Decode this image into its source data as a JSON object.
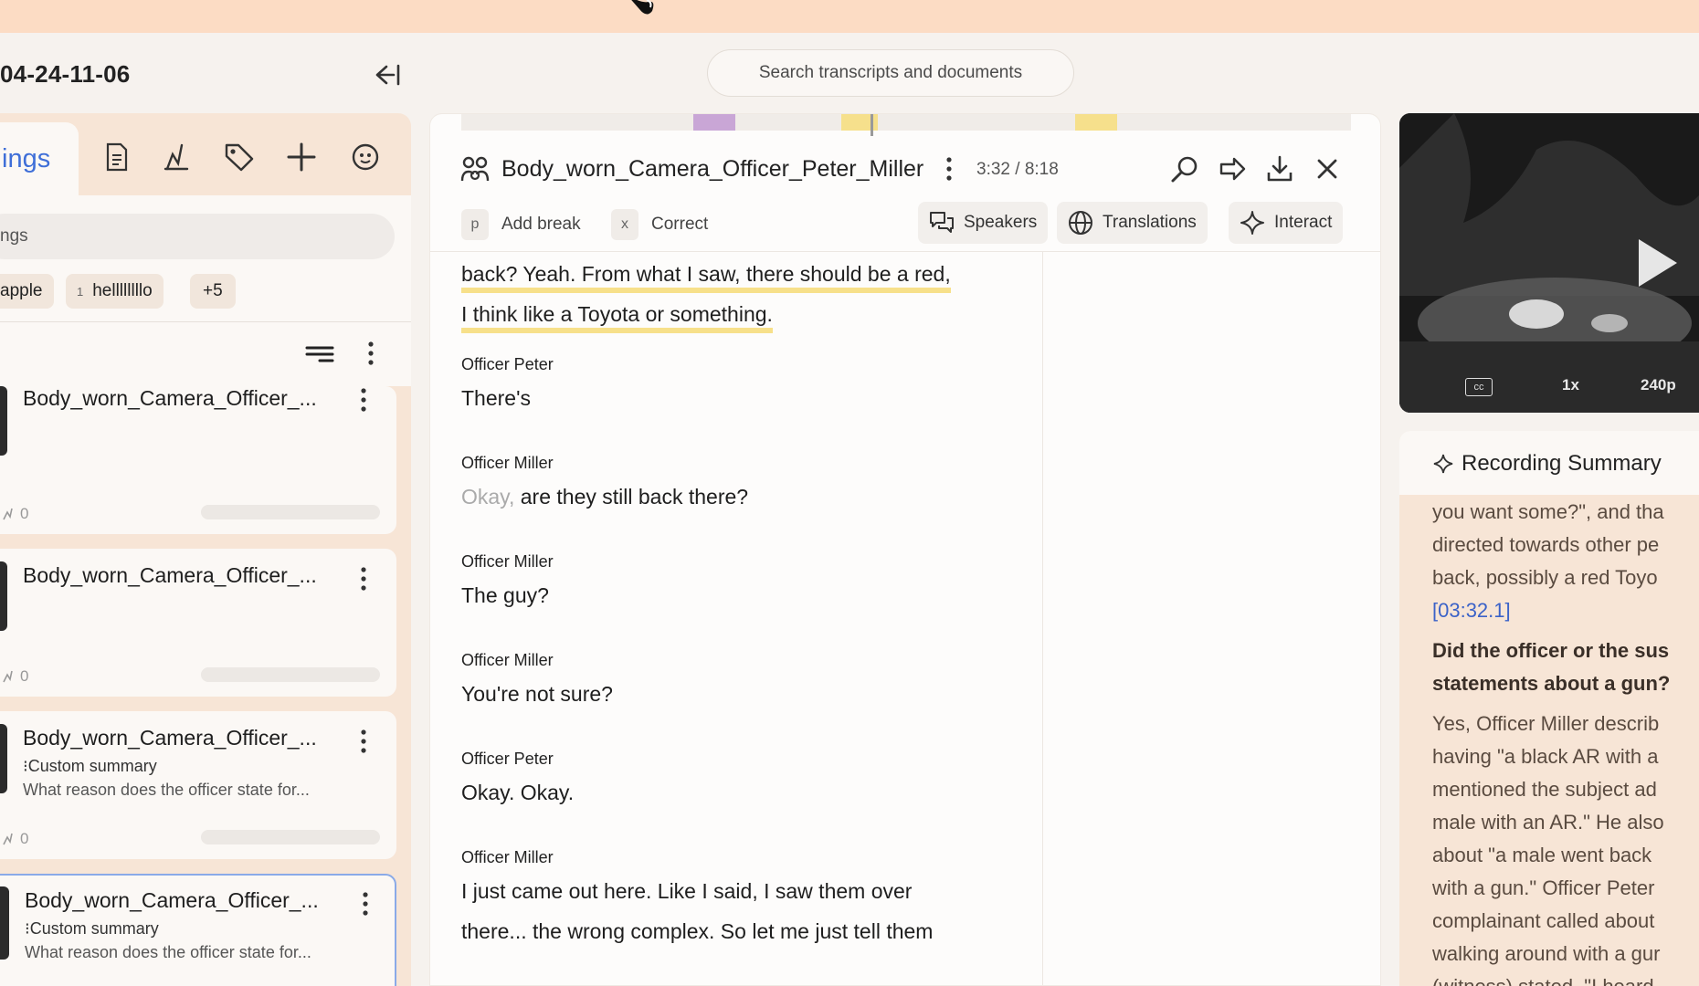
{
  "session": {
    "title": "04-24-11-06"
  },
  "search": {
    "placeholder": "Search transcripts and documents"
  },
  "left_panel": {
    "active_tab_label": "ings",
    "tab_icons": [
      "document-icon",
      "signature-icon",
      "tag-icon",
      "plus-icon",
      "face-scan-icon"
    ],
    "filter_placeholder": "ngs",
    "tags": [
      {
        "label": "apple",
        "count": ""
      },
      {
        "label": "hellllllllo",
        "count": "1"
      },
      {
        "label": "+5",
        "count": ""
      }
    ],
    "recordings": [
      {
        "title": "Body_worn_Camera_Officer_...",
        "summary_label": "",
        "summary_text": "",
        "count": "0"
      },
      {
        "title": "Body_worn_Camera_Officer_...",
        "summary_label": "",
        "summary_text": "",
        "count": "0"
      },
      {
        "title": "Body_worn_Camera_Officer_...",
        "summary_label": "Custom summary",
        "summary_text": "What reason does the officer state for...",
        "count": "0"
      },
      {
        "title": "Body_worn_Camera_Officer_...",
        "summary_label": "Custom summary",
        "summary_text": "What reason does the officer state for...",
        "count": ""
      }
    ]
  },
  "transcript": {
    "title": "Body_worn_Camera_Officer_Peter_Miller",
    "time": "3:32 / 8:18",
    "tools": {
      "add_break_key": "p",
      "add_break": "Add break",
      "correct_key": "x",
      "correct": "Correct",
      "speakers": "Speakers",
      "translations": "Translations",
      "interact": "Interact"
    },
    "lines": {
      "l1": "back? Yeah. From what I saw, there should be a red,",
      "l2": "I think like a Toyota or something."
    },
    "turns": [
      {
        "speaker": "Officer Peter",
        "text": "There's",
        "muted": ""
      },
      {
        "speaker": "Officer Miller",
        "text": "are they still back there?",
        "muted": "Okay,"
      },
      {
        "speaker": "Officer Miller",
        "text": "The guy?",
        "muted": ""
      },
      {
        "speaker": "Officer Miller",
        "text": "You're not sure?",
        "muted": ""
      },
      {
        "speaker": "Officer Peter",
        "text": "Okay. Okay.",
        "muted": ""
      },
      {
        "speaker": "Officer Miller",
        "text": "I just came out here. Like I said, I saw them over",
        "muted": ""
      }
    ],
    "continuation": "there... the wrong complex. So let me just tell them",
    "timeline_colors": {
      "purple": "#c9a6d6",
      "yellow": "#f6e08c"
    }
  },
  "video": {
    "cc": "cc",
    "speed": "1x",
    "quality": "240p"
  },
  "summary": {
    "title": "Recording Summary",
    "lines": [
      "you want some?\", and tha",
      "directed towards other pe",
      "back, possibly a red Toyo"
    ],
    "timestamp": "[03:32.1]",
    "question_lines": [
      "Did the officer or the sus",
      "statements about a gun?"
    ],
    "answer_lines": [
      "Yes, Officer Miller describ",
      "having \"a black AR with a",
      "mentioned the subject ad",
      "male with an AR.\" He also",
      "about \"a male went back",
      "with a gun.\" Officer Peter",
      "complainant called about",
      "walking around with a gur",
      "(witness) stated, \"I heard"
    ]
  },
  "colors": {
    "accent": "#3f6fd8",
    "highlight": "#f7e08a",
    "panel": "#f7e5d6"
  }
}
